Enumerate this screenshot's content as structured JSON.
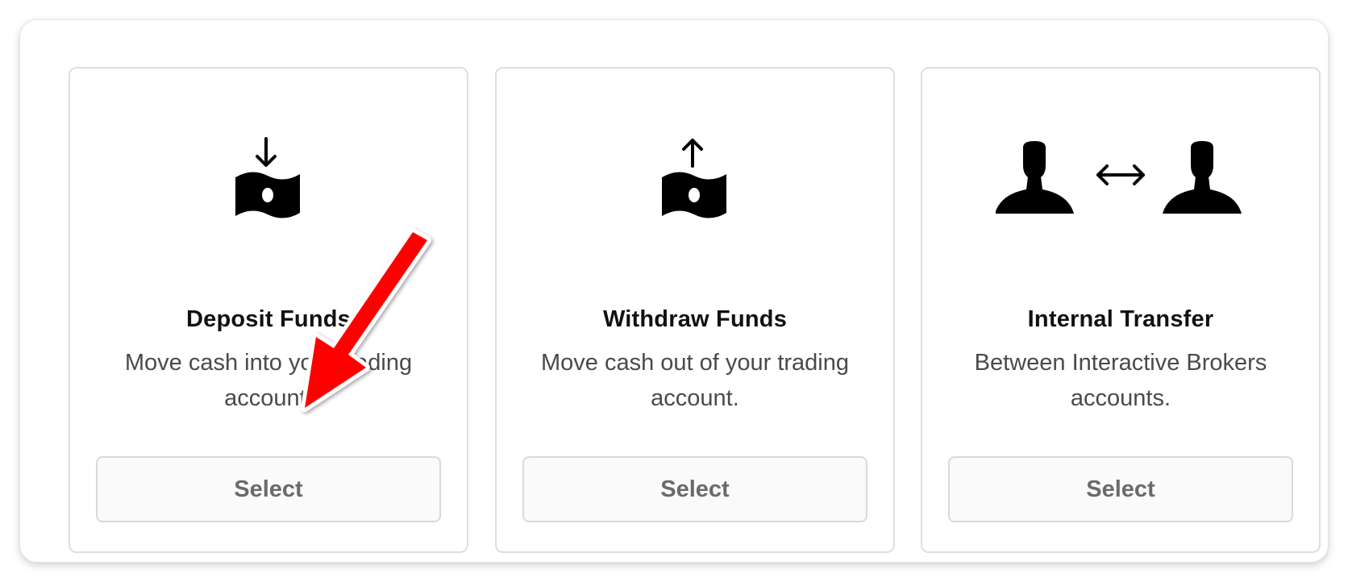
{
  "cards": [
    {
      "title": "Deposit Funds",
      "description": "Move cash into your trading account.",
      "button_label": "Select",
      "icon": "deposit-money-icon"
    },
    {
      "title": "Withdraw Funds",
      "description": "Move cash out of your trading account.",
      "button_label": "Select",
      "icon": "withdraw-money-icon"
    },
    {
      "title": "Internal Transfer",
      "description": "Between Interactive Brokers accounts.",
      "button_label": "Select",
      "icon": "user-transfer-icon"
    }
  ],
  "annotation": {
    "type": "red-arrow",
    "color": "#ff0000"
  }
}
